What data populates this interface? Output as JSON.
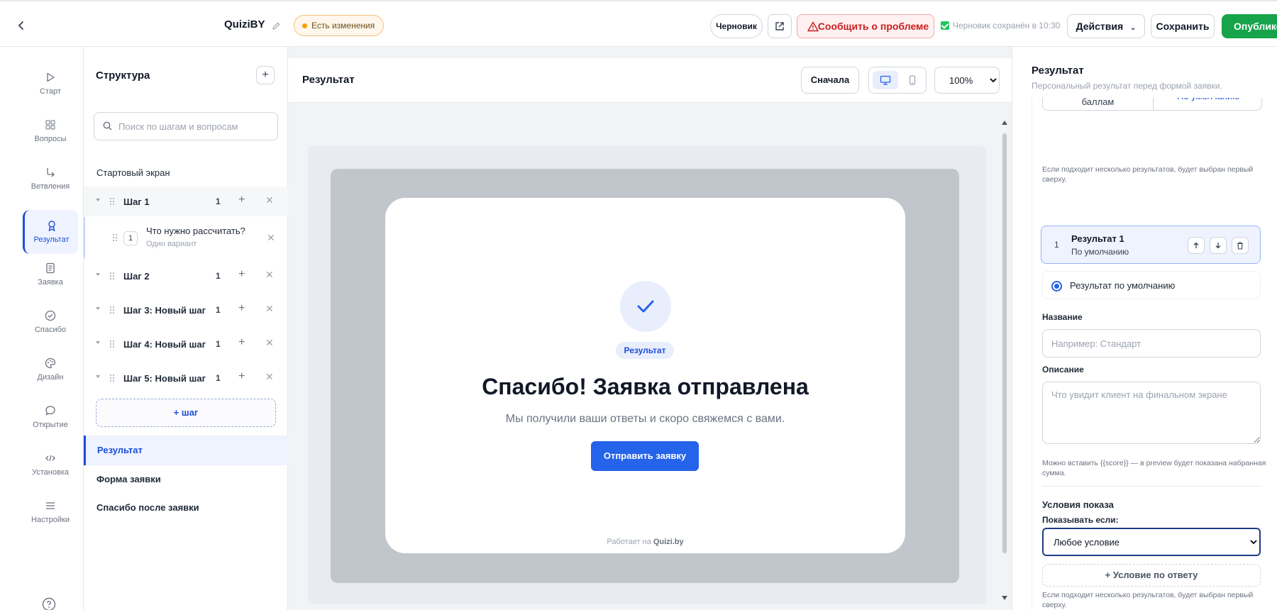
{
  "header": {
    "app_title": "QuiziBY",
    "changes_badge": "Есть изменения",
    "draft_button": "Черновик",
    "report_button": "Сообщить о проблеме",
    "saved_status": "Черновик сохранён в 10:30",
    "actions_button": "Действия",
    "save_button": "Сохранить",
    "publish_button": "Опублико"
  },
  "leftnav": {
    "items": [
      {
        "label": "Старт",
        "icon": "play-icon"
      },
      {
        "label": "Вопросы",
        "icon": "grid-icon"
      },
      {
        "label": "Ветвления",
        "icon": "branch-icon"
      },
      {
        "label": "Результат",
        "icon": "award-icon",
        "active": true
      },
      {
        "label": "Заявка",
        "icon": "document-icon"
      },
      {
        "label": "Спасибо",
        "icon": "check-circle-icon"
      },
      {
        "label": "Дизайн",
        "icon": "palette-icon"
      },
      {
        "label": "Открытие",
        "icon": "chat-bubble-icon"
      },
      {
        "label": "Установка",
        "icon": "code-icon"
      },
      {
        "label": "Настройки",
        "icon": "menu-icon"
      }
    ]
  },
  "structure": {
    "title": "Структура",
    "search_placeholder": "Поиск по шагам и вопросам",
    "start_screen": "Стартовый экран",
    "steps": [
      {
        "label": "Шаг 1",
        "count": "1"
      },
      {
        "label": "Шаг 2",
        "count": "1"
      },
      {
        "label": "Шаг 3: Новый шаг",
        "count": "1"
      },
      {
        "label": "Шаг 4: Новый шаг",
        "count": "1"
      },
      {
        "label": "Шаг 5: Новый шаг",
        "count": "1"
      }
    ],
    "question": {
      "number": "1",
      "title": "Что нужно рассчитать?",
      "subtitle": "Один вариант"
    },
    "add_step": "+ шаг",
    "result": "Результат",
    "form": "Форма заявки",
    "thanks": "Спасибо после заявки"
  },
  "preview": {
    "title": "Результат",
    "restart_button": "Сначала",
    "zoom": "100%",
    "zoom_options": [
      "100%"
    ],
    "card": {
      "badge": "Результат",
      "title": "Спасибо! Заявка отправлена",
      "subtitle": "Мы получили ваши ответы и скоро свяжемся с вами.",
      "button": "Отправить заявку",
      "footer_prefix": "Работает на",
      "footer_brand": "Quizi.by"
    }
  },
  "rightpanel": {
    "title": "Результат",
    "subtitle": "Персональный результат перед формой заявки.",
    "tab_scores": "баллам",
    "tab_default": "По умолчанию",
    "hint": "Если подходит несколько результатов, будет выбран первый сверху.",
    "result_card": {
      "number": "1",
      "title": "Результат 1",
      "subtitle": "По умолчанию"
    },
    "default_radio": "Результат по умолчанию",
    "name_label": "Название",
    "name_placeholder": "Например: Стандарт",
    "description_label": "Описание",
    "description_placeholder": "Что увидит клиент на финальном экране",
    "score_hint": "Можно вставить {{score}} — в preview будет показана набранная сумма.",
    "conditions_title": "Условия показа",
    "show_if_label": "Показывать если:",
    "condition_value": "Любое условие",
    "condition_options": [
      "Любое условие"
    ],
    "add_condition": "+ Условие по ответу",
    "bottom_hint": "Если подходит несколько результатов, будет выбран первый сверху."
  },
  "colors": {
    "accent": "#2563eb",
    "publish": "#16a34a",
    "report": "#c81e1e",
    "badge_warning": "#f59e0b"
  }
}
